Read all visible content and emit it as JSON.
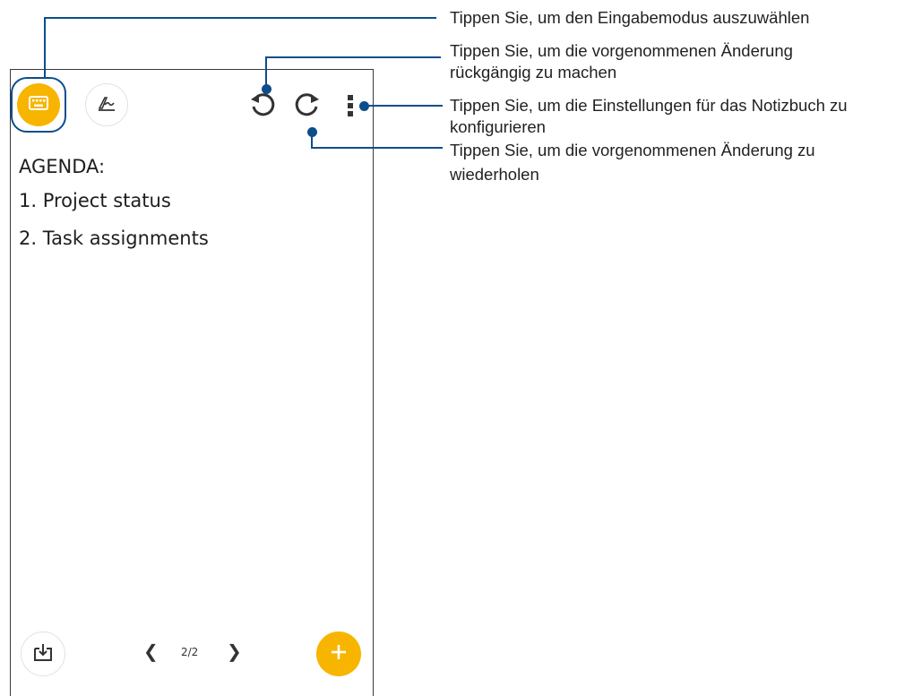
{
  "notebook": {
    "lines": [
      "AGENDA:",
      "1. Project status",
      "2. Task assignments"
    ],
    "pager": {
      "current": "2/2",
      "prev_glyph": "❮",
      "next_glyph": "❯"
    }
  },
  "toolbar": {
    "keyboard_icon": "keyboard-icon",
    "handwrite_icon": "handwriting-icon",
    "undo_icon": "undo-icon",
    "redo_icon": "redo-icon",
    "more_icon": "more-vertical-icon"
  },
  "callouts": {
    "input_mode": "Tippen Sie, um den Eingabemodus auszuwählen",
    "undo_line1": "Tippen Sie, um die vorgenommenen Änderung",
    "undo_line2": "rückgängig zu machen",
    "settings_line1": "Tippen Sie, um die Einstellungen für das Notizbuch zu",
    "settings_line2": "konfigurieren",
    "redo_line1": "Tippen Sie, um die vorgenommenen Änderung zu",
    "redo_line2": "wiederholen"
  },
  "colors": {
    "accent_yellow": "#f7b500",
    "callout_blue": "#0c4d8c"
  }
}
